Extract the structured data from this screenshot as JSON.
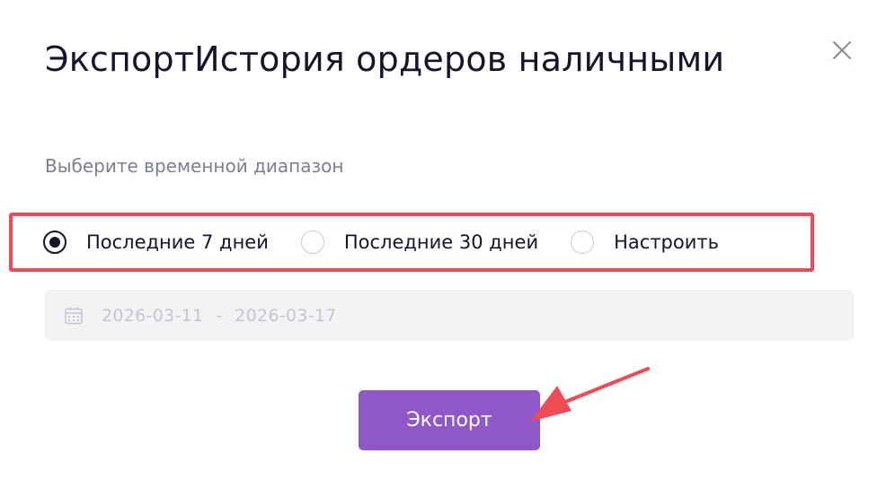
{
  "dialog": {
    "title": "ЭкспортИстория ордеров наличными",
    "close_icon": "close-icon",
    "subtitle": "Выберите временной диапазон"
  },
  "range_options": [
    {
      "label": "Последние 7 дней",
      "checked": true
    },
    {
      "label": "Последние 30 дней",
      "checked": false
    },
    {
      "label": "Настроить",
      "checked": false
    }
  ],
  "date_range": {
    "icon": "calendar-icon",
    "start": "2026-03-11",
    "separator": "-",
    "end": "2026-03-17"
  },
  "export_button": {
    "label": "Экспорт",
    "color": "#8f57c9"
  },
  "annotation": {
    "highlight_color": "#f04b55",
    "arrow_color": "#f04b55"
  }
}
